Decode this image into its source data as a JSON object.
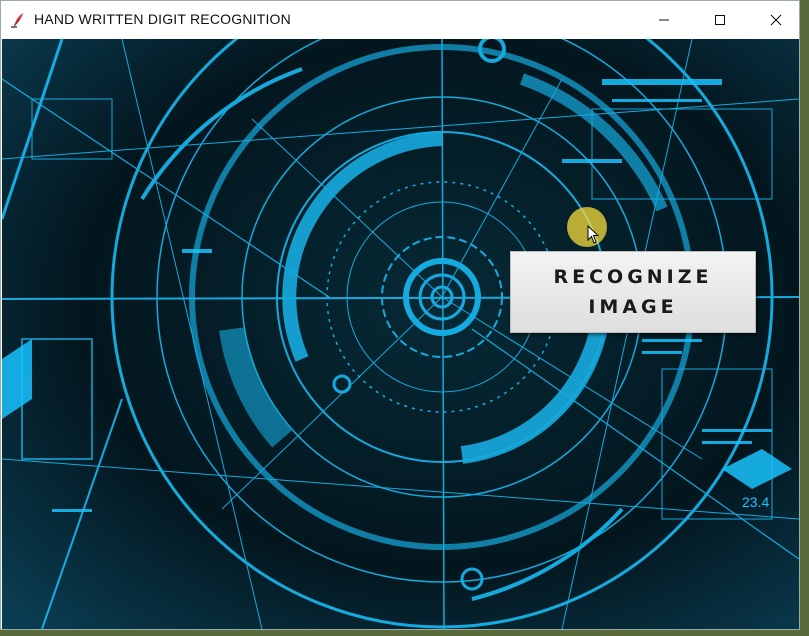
{
  "window": {
    "title": "HAND WRITTEN DIGIT RECOGNITION",
    "app_icon": "feather-app-icon",
    "controls": {
      "minimize_icon": "minimize-icon",
      "maximize_icon": "maximize-icon",
      "close_icon": "close-icon"
    }
  },
  "background": {
    "description_icon": "hud-circular-interface",
    "readouts": [
      "23.4"
    ],
    "colors": {
      "glow": "#19c3ff",
      "dark": "#041820"
    }
  },
  "recognize_button": {
    "label": "RECOGNIZE IMAGE"
  }
}
